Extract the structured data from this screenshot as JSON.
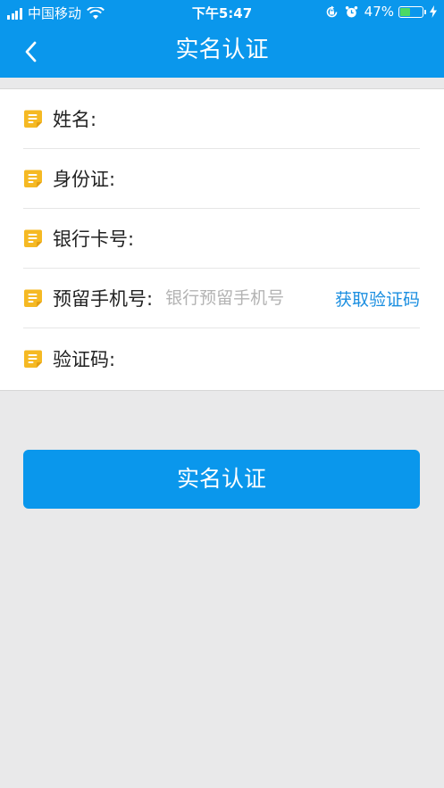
{
  "status_bar": {
    "carrier": "中国移动",
    "time": "下午5:47",
    "battery_text": "47%"
  },
  "nav": {
    "title": "实名认证"
  },
  "form": {
    "fields": [
      {
        "label": "姓名:",
        "value": ""
      },
      {
        "label": "身份证:",
        "value": ""
      },
      {
        "label": "银行卡号:",
        "value": ""
      },
      {
        "label": "预留手机号:",
        "value": "",
        "placeholder": "银行预留手机号",
        "action": "获取验证码"
      },
      {
        "label": "验证码:",
        "value": ""
      }
    ]
  },
  "submit": {
    "label": "实名认证"
  },
  "colors": {
    "primary": "#0a97ec",
    "icon": "#f5b923",
    "link": "#1a8ee0",
    "background": "#e9e9ea"
  },
  "icons": [
    "signal-icon",
    "wifi-icon",
    "orientation-lock-icon",
    "alarm-icon",
    "battery-icon",
    "charging-icon",
    "back-icon",
    "note-icon"
  ]
}
